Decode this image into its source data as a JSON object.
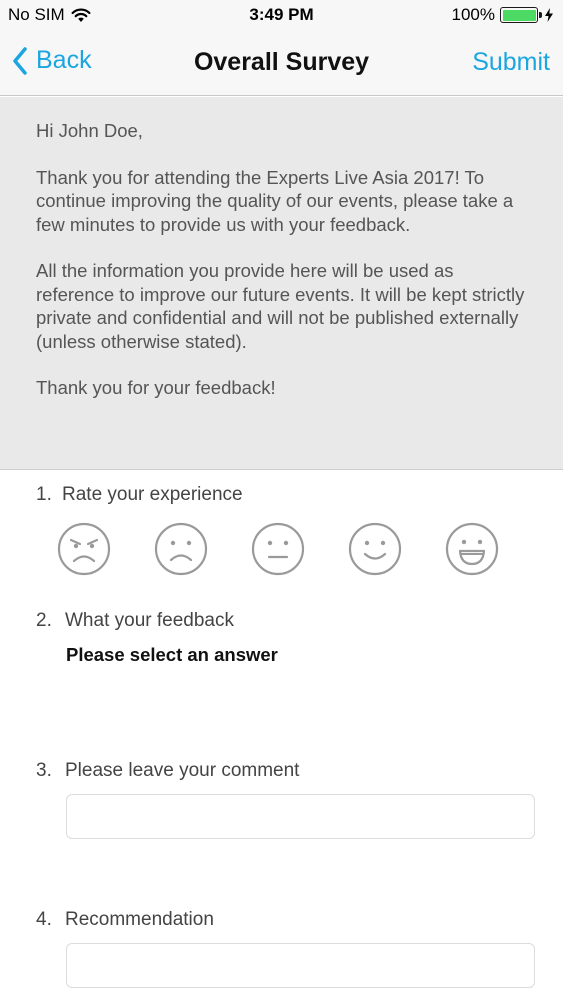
{
  "status_bar": {
    "carrier": "No SIM",
    "time": "3:49 PM",
    "battery": "100%",
    "battery_level": 1.0,
    "battery_color": "#4cd964"
  },
  "nav": {
    "back_label": "Back",
    "title": "Overall Survey",
    "submit_label": "Submit",
    "accent_color": "#1ba6e0"
  },
  "intro": {
    "greeting": "Hi John Doe,",
    "paragraph1": "Thank you for attending the Experts Live Asia 2017! To continue improving the quality of our events, please take a few minutes to provide us with your feedback.",
    "paragraph2": "All the information you provide here will be used as reference to improve our future events. It will be kept strictly private and confidential and will not be published externally (unless otherwise stated).",
    "closing": "Thank you for your feedback!"
  },
  "questions": [
    {
      "number": "1.",
      "label": "Rate your experience",
      "ratings": [
        {
          "icon": "angry-face-icon"
        },
        {
          "icon": "sad-face-icon"
        },
        {
          "icon": "neutral-face-icon"
        },
        {
          "icon": "smile-face-icon"
        },
        {
          "icon": "grin-face-icon"
        }
      ]
    },
    {
      "number": "2.",
      "label": "What your feedback",
      "hint": "Please select an answer"
    },
    {
      "number": "3.",
      "label": "Please leave your comment",
      "value": "",
      "placeholder": ""
    },
    {
      "number": "4.",
      "label": "Recommendation",
      "value": "",
      "placeholder": ""
    }
  ]
}
